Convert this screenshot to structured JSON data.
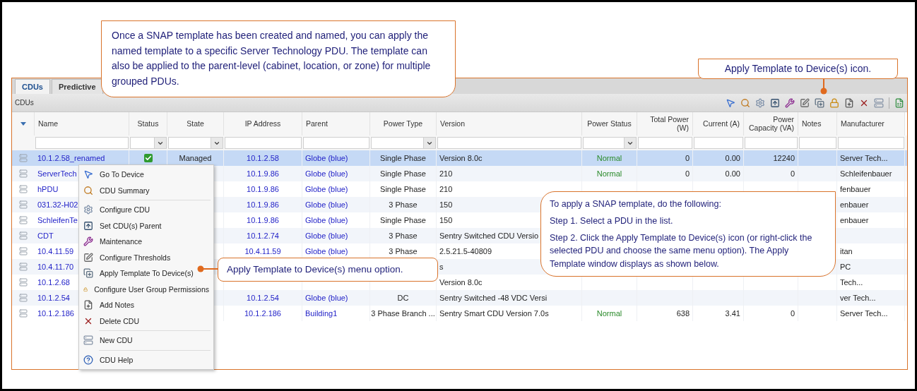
{
  "callouts": {
    "intro": "Once a SNAP template has been created and named, you can apply the named template to a specific Server Technology PDU. The template can also be applied to the parent-level (cabinet, location, or zone) for multiple grouped PDUs.",
    "icon_note": "Apply Template to Device(s) icon.",
    "menu_note": "Apply Template to Device(s) menu option.",
    "steps": [
      "To apply a SNAP template, do the following:",
      "Step 1. Select a PDU in the list.",
      "Step 2. Click the Apply Template to Device(s) icon (or right-click the selected PDU and choose the same menu option). The Apply Template window displays as shown below."
    ]
  },
  "tabs": [
    {
      "label": "CDUs",
      "selected": true
    },
    {
      "label": "Predictive",
      "selected": false
    }
  ],
  "panel_title": "CDUs",
  "table": {
    "columns": [
      {
        "label": "Name",
        "kind": "text"
      },
      {
        "label": "Status",
        "kind": "dropdown"
      },
      {
        "label": "State",
        "kind": "dropdown"
      },
      {
        "label": "IP Address",
        "kind": "text"
      },
      {
        "label": "Parent",
        "kind": "text"
      },
      {
        "label": "Power Type",
        "kind": "dropdown"
      },
      {
        "label": "Version",
        "kind": "text"
      },
      {
        "label": "Power Status",
        "kind": "dropdown"
      },
      {
        "label": "Total Power (W)",
        "kind": "text"
      },
      {
        "label": "Current (A)",
        "kind": "text"
      },
      {
        "label": "Power Capacity (VA)",
        "kind": "text"
      },
      {
        "label": "Notes",
        "kind": "text"
      },
      {
        "label": "Manufacturer",
        "kind": "text"
      }
    ],
    "rows": [
      {
        "selected": true,
        "status_ok": true,
        "cells": [
          "10.1.2.58_renamed",
          null,
          "Managed",
          "10.1.2.58",
          "Globe (blue)",
          "Single Phase",
          "Version 8.0c",
          "Normal",
          "0",
          "0.00",
          "12240",
          null,
          "Server Tech..."
        ]
      },
      {
        "selected": false,
        "cells": [
          "ServerTech",
          null,
          null,
          "10.1.9.86",
          "Globe (blue)",
          "Single Phase",
          "210",
          "Normal",
          "0",
          "0.00",
          "0",
          null,
          "Schleifenbauer"
        ]
      },
      {
        "selected": false,
        "cells": [
          "hPDU",
          null,
          null,
          "10.1.9.86",
          "Globe (blue)",
          "Single Phase",
          "210",
          null,
          null,
          null,
          null,
          null,
          "fenbauer"
        ]
      },
      {
        "selected": false,
        "cells": [
          "031.32-H02",
          null,
          null,
          "10.1.9.86",
          "Globe (blue)",
          "3 Phase",
          "150",
          null,
          null,
          null,
          null,
          null,
          "enbauer"
        ]
      },
      {
        "selected": false,
        "cells": [
          "SchleifenTe",
          null,
          null,
          "10.1.9.86",
          "Globe (blue)",
          "Single Phase",
          "150",
          null,
          null,
          null,
          null,
          null,
          "enbauer"
        ]
      },
      {
        "selected": false,
        "cells": [
          "CDT",
          null,
          null,
          "10.1.2.74",
          "Globe (blue)",
          "3 Phase",
          "Sentry Switched CDU Versio",
          null,
          null,
          null,
          null,
          null,
          null
        ]
      },
      {
        "selected": false,
        "cells": [
          "10.4.11.59",
          null,
          null,
          "10.4.11.59",
          "Globe (blue)",
          "3 Phase",
          "2.5.21.5-40809",
          null,
          null,
          null,
          null,
          null,
          "itan"
        ]
      },
      {
        "selected": false,
        "cells": [
          "10.4.11.70",
          null,
          null,
          null,
          null,
          null,
          "s",
          null,
          null,
          null,
          null,
          null,
          "PC"
        ]
      },
      {
        "selected": false,
        "cells": [
          "10.1.2.68",
          null,
          null,
          null,
          null,
          null,
          "Version 8.0c",
          null,
          null,
          null,
          null,
          null,
          "Tech..."
        ]
      },
      {
        "selected": false,
        "cells": [
          "10.1.2.54",
          null,
          null,
          "10.1.2.54",
          "Globe (blue)",
          "DC",
          "Sentry Switched -48 VDC Versi",
          null,
          null,
          null,
          null,
          null,
          "ver Tech..."
        ]
      },
      {
        "selected": false,
        "cells": [
          "10.1.2.186",
          null,
          null,
          "10.1.2.186",
          "Building1",
          "3 Phase Branch ...",
          "Sentry Smart CDU Version 7.0s",
          "Normal",
          "638",
          "3.41",
          "0",
          null,
          "Server Tech..."
        ]
      }
    ]
  },
  "context_menu": {
    "groups": [
      [
        "Go To Device",
        "CDU Summary"
      ],
      [
        "Configure CDU",
        "Set CDU(s) Parent",
        "Maintenance",
        "Configure Thresholds",
        "Apply Template To Device(s)",
        "Configure User Group Permissions",
        "Add Notes",
        "Delete CDU"
      ],
      [
        "New CDU"
      ],
      [
        "CDU Help"
      ]
    ]
  }
}
